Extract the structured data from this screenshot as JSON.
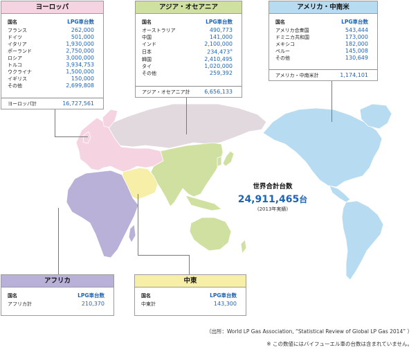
{
  "colors": {
    "europe": "#f6d3e1",
    "asia_oceania": "#cfe0a0",
    "americas": "#b7dcf2",
    "africa": "#b9b1d8",
    "middle_east": "#f7efa8",
    "russia_gray": "#e2d9df",
    "value_blue": "#1f63b4"
  },
  "column_header": {
    "country": "国名",
    "value": "LPG車台数"
  },
  "europe": {
    "title": "ヨーロッパ",
    "rows": [
      {
        "name": "フランス",
        "value": "262,000"
      },
      {
        "name": "ドイツ",
        "value": "501,000"
      },
      {
        "name": "イタリア",
        "value": "1,930,000"
      },
      {
        "name": "ポーランド",
        "value": "2,750,000"
      },
      {
        "name": "ロシア",
        "value": "3,000,000"
      },
      {
        "name": "トルコ",
        "value": "3,934,753"
      },
      {
        "name": "ウクライナ",
        "value": "1,500,000"
      },
      {
        "name": "イギリス",
        "value": "150,000"
      },
      {
        "name": "その他",
        "value": "2,699,808"
      }
    ],
    "total_label": "ヨーロッパ計",
    "total_value": "16,727,561"
  },
  "asia": {
    "title": "アジア・オセアニア",
    "rows": [
      {
        "name": "オーストラリア",
        "value": "490,773"
      },
      {
        "name": "中国",
        "value": "141,000"
      },
      {
        "name": "インド",
        "value": "2,100,000"
      },
      {
        "name": "日本",
        "value": "234,473",
        "note": "※"
      },
      {
        "name": "韓国",
        "value": "2,410,495"
      },
      {
        "name": "タイ",
        "value": "1,020,000"
      },
      {
        "name": "その他",
        "value": "259,392"
      }
    ],
    "total_label": "アジア・オセアニア計",
    "total_value": "6,656,133"
  },
  "americas": {
    "title": "アメリカ・中南米",
    "rows": [
      {
        "name": "アメリカ合衆国",
        "value": "543,444"
      },
      {
        "name": "ドミニカ共和国",
        "value": "173,000"
      },
      {
        "name": "メキシコ",
        "value": "182,000"
      },
      {
        "name": "ペルー",
        "value": "145,008"
      },
      {
        "name": "その他",
        "value": "130,649"
      },
      {
        "name": "アメリカ・中南米計",
        "value": "1,174,101"
      }
    ]
  },
  "africa": {
    "title": "アフリカ",
    "total_label": "アフリカ計",
    "total_value": "210,370"
  },
  "middle_east": {
    "title": "中東",
    "total_label": "中東計",
    "total_value": "143,300"
  },
  "world": {
    "label": "世界合計台数",
    "value": "24,911,465",
    "unit": "台",
    "year_note": "(2013年実績)"
  },
  "footer": {
    "source": "（出所：World LP Gas Association, “Statistical Review of Global LP Gas 2014” ）",
    "note": "※ この数値にはバイフューエル車の台数は含まれていません。"
  }
}
